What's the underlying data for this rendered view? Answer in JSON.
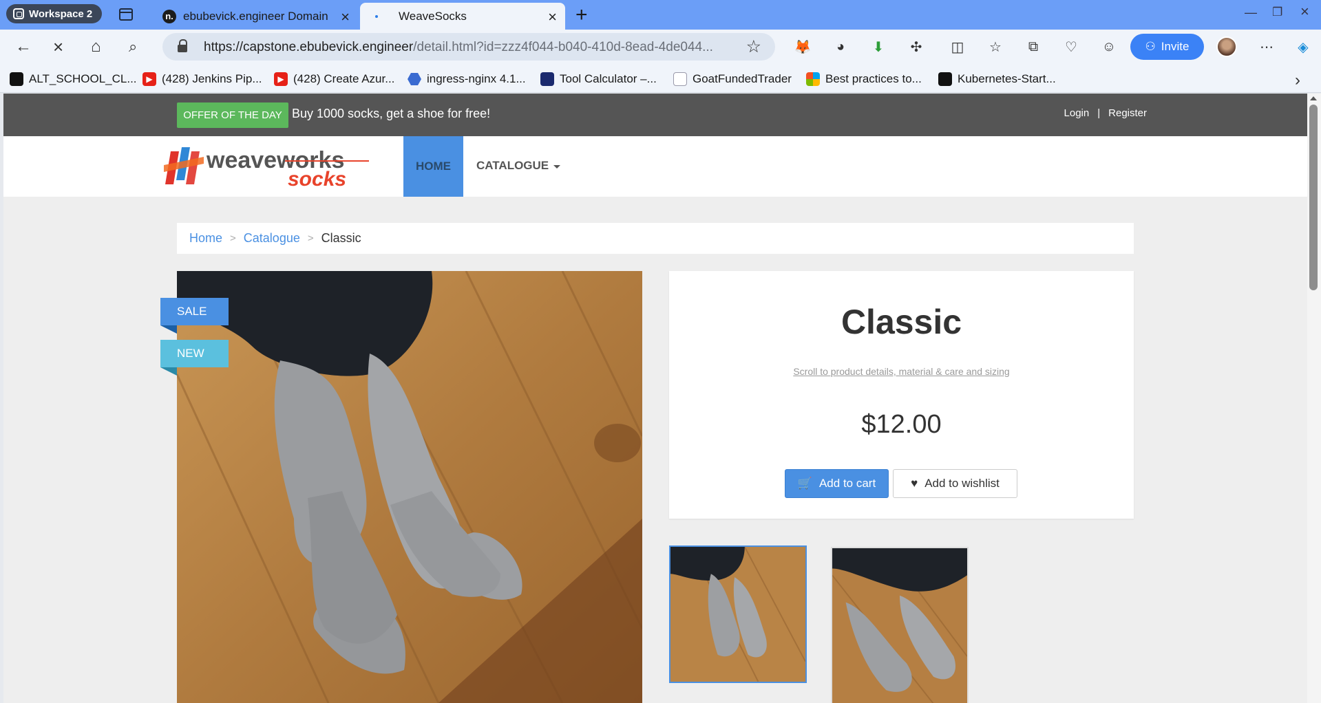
{
  "browser": {
    "workspace_label": "Workspace 2",
    "tabs": [
      {
        "title": "ebubevick.engineer Domain",
        "favicon": "n."
      },
      {
        "title": "WeaveSocks"
      }
    ],
    "url_host": "https://capstone.ebubevick.engineer",
    "url_path": "/detail.html?id=zzz4f044-b040-410d-8ead-4de044...",
    "invite_label": "Invite",
    "bookmarks": [
      {
        "label": "ALT_SCHOOL_CL...",
        "icon": "github-icon"
      },
      {
        "label": "(428) Jenkins Pip...",
        "icon": "youtube-icon"
      },
      {
        "label": "(428) Create Azur...",
        "icon": "youtube-icon"
      },
      {
        "label": "ingress-nginx 4.1...",
        "icon": "hexagon-icon"
      },
      {
        "label": "Tool Calculator –...",
        "icon": "moon-icon"
      },
      {
        "label": "GoatFundedTrader",
        "icon": "goat-icon"
      },
      {
        "label": "Best practices to...",
        "icon": "microsoft-icon"
      },
      {
        "label": "Kubernetes-Start...",
        "icon": "github-icon"
      }
    ]
  },
  "site": {
    "offer_badge": "OFFER OF THE DAY",
    "offer_text": "Buy 1000 socks, get a shoe for free!",
    "login": "Login",
    "separator": "|",
    "register": "Register",
    "logo_top": "weaveworks",
    "logo_bottom": "socks",
    "nav": {
      "home": "HOME",
      "catalogue": "CATALOGUE"
    },
    "breadcrumb": {
      "home": "Home",
      "sep": ">",
      "catalogue": "Catalogue",
      "current": "Classic"
    },
    "ribbons": {
      "sale": "SALE",
      "new": "NEW"
    },
    "product": {
      "title": "Classic",
      "scroll_link": "Scroll to product details, material & care and sizing",
      "price": "$12.00",
      "add_to_cart": "Add to cart",
      "add_to_wishlist": "Add to wishlist"
    }
  },
  "colors": {
    "primary": "#4a90e2",
    "offer_green": "#5cb85c",
    "topbar": "#555555",
    "new_ribbon": "#5bc0de"
  }
}
